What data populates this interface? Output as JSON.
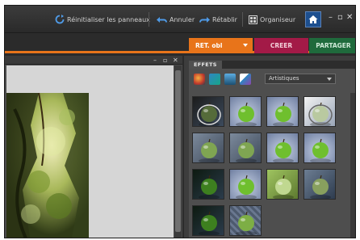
{
  "toolbar": {
    "reset_label": "Réinitialiser les panneaux",
    "undo_label": "Annuler",
    "redo_label": "Rétablir",
    "organizer_label": "Organiseur"
  },
  "window_controls": {
    "minimize": "–",
    "restore": "▫",
    "close": "✕"
  },
  "mode_tabs": {
    "edit_label": "RET. obl",
    "create_label": "CREER",
    "share_label": "PARTAGER"
  },
  "colors": {
    "accent_orange": "#e8741a",
    "create_tab": "#a31a47",
    "share_tab": "#1f6a3c"
  },
  "document": {
    "controls": {
      "minimize": "–",
      "restore": "▫",
      "close": "✕"
    }
  },
  "effects_panel": {
    "tab_label": "EFFETS",
    "category": "Artistiques",
    "effect_type_icons": [
      "filters-icon",
      "layer-styles-icon",
      "photo-effects-icon",
      "all-effects-icon"
    ],
    "thumbnails": [
      {
        "style": "dark-outline"
      },
      {
        "style": "green-apple"
      },
      {
        "style": "green-apple"
      },
      {
        "style": "sketch-light"
      },
      {
        "style": "muted-green"
      },
      {
        "style": "muted-green"
      },
      {
        "style": "green-apple"
      },
      {
        "style": "green-apple"
      },
      {
        "style": "dark-green"
      },
      {
        "style": "green-apple"
      },
      {
        "style": "blurred-green"
      },
      {
        "style": "grey-blue"
      },
      {
        "style": "dark-green"
      },
      {
        "style": "patterned"
      }
    ]
  }
}
